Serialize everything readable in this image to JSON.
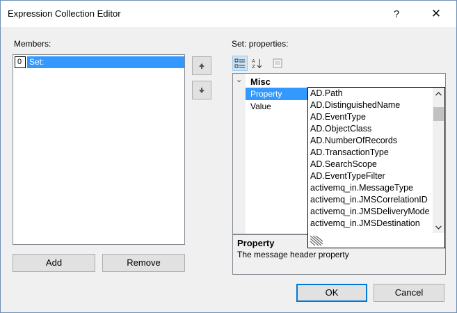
{
  "window": {
    "title": "Expression Collection Editor",
    "help_glyph": "?",
    "close_glyph": "✕"
  },
  "members": {
    "label": "Members:",
    "items": [
      {
        "index": "0",
        "name": "Set:"
      }
    ]
  },
  "buttons": {
    "add": "Add",
    "remove": "Remove",
    "ok": "OK",
    "cancel": "Cancel"
  },
  "properties": {
    "label_prefix": "Set:",
    "label_suffix": "properties:",
    "category": "Misc",
    "category_toggle": "⌄",
    "rows": [
      {
        "name": "Property"
      },
      {
        "name": "Value"
      }
    ],
    "dropdown_options": [
      "AD.Path",
      "AD.DistinguishedName",
      "AD.EventType",
      "AD.ObjectClass",
      "AD.NumberOfRecords",
      "AD.TransactionType",
      "AD.SearchScope",
      "AD.EventTypeFilter",
      "activemq_in.MessageType",
      "activemq_in.JMSCorrelationID",
      "activemq_in.JMSDeliveryMode",
      "activemq_in.JMSDestination"
    ]
  },
  "description": {
    "title": "Property",
    "text": "The message header property"
  },
  "colors": {
    "selection": "#3399ff",
    "window_bg": "#f0f0f0",
    "button_bg": "#e1e1e1",
    "default_button_border": "#0078d7"
  },
  "icons": {
    "categorized": "categorized-icon",
    "alphabetical": "alphabetical-sort-icon",
    "property_pages": "property-pages-icon",
    "move_up": "arrow-up-icon",
    "move_down": "arrow-down-icon"
  }
}
